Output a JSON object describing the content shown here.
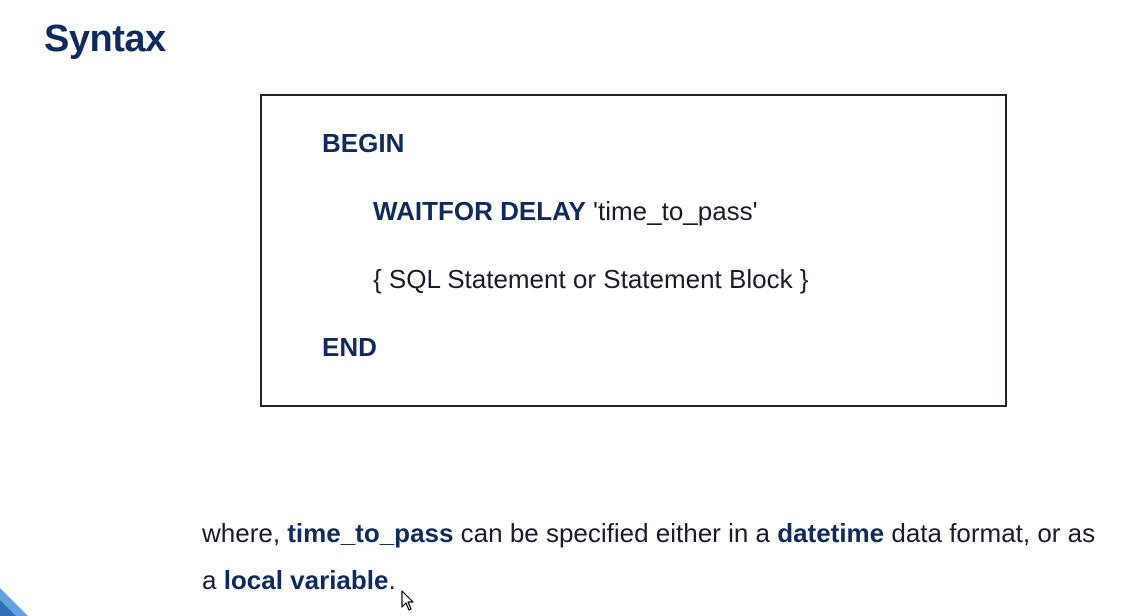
{
  "slide": {
    "title": "Syntax"
  },
  "code": {
    "begin": "BEGIN",
    "waitfor_kw": "WAITFOR DELAY",
    "waitfor_arg": " 'time_to_pass'",
    "statement": "{ SQL Statement or Statement Block }",
    "end": "END"
  },
  "note": {
    "t1": "where, ",
    "b1": "time_to_pass",
    "t2": " can be specified either in a ",
    "b2": "datetime",
    "t3": " data format, or as a ",
    "b3": "local variable",
    "t4": "."
  },
  "colors": {
    "title": "#0f2a5c",
    "border": "#1f2433",
    "accent_corner": "#4a90d9"
  }
}
